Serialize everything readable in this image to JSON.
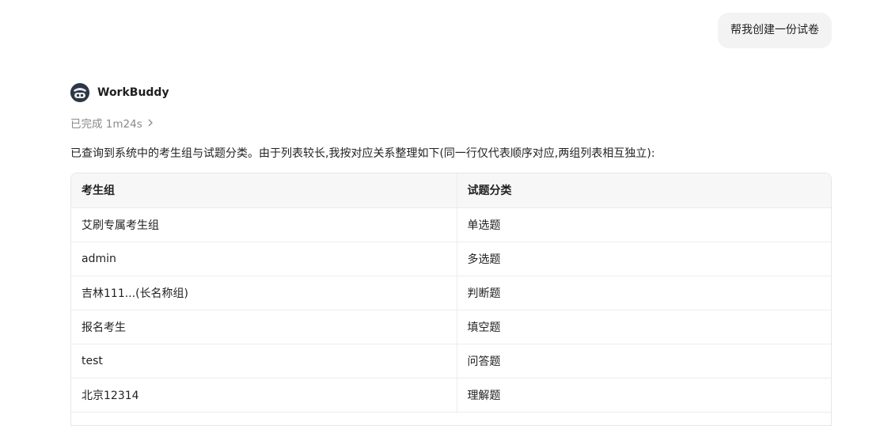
{
  "user_message": "帮我创建一份试卷",
  "agent": {
    "name": "WorkBuddy",
    "avatar_icon": "robot-avatar-icon",
    "status": "已完成 1m24s"
  },
  "summary": "已查询到系统中的考生组与试题分类。由于列表较长,我按对应关系整理如下(同一行仅代表顺序对应,两组列表相互独立):",
  "table": {
    "headers": [
      "考生组",
      "试题分类"
    ],
    "rows": [
      [
        "艾刷专属考生组",
        "单选题"
      ],
      [
        "admin",
        "多选题"
      ],
      [
        "吉林111...(长名称组)",
        "判断题"
      ],
      [
        "报名考生",
        "填空题"
      ],
      [
        "test",
        "问答题"
      ],
      [
        "北京12314",
        "理解题"
      ]
    ]
  }
}
